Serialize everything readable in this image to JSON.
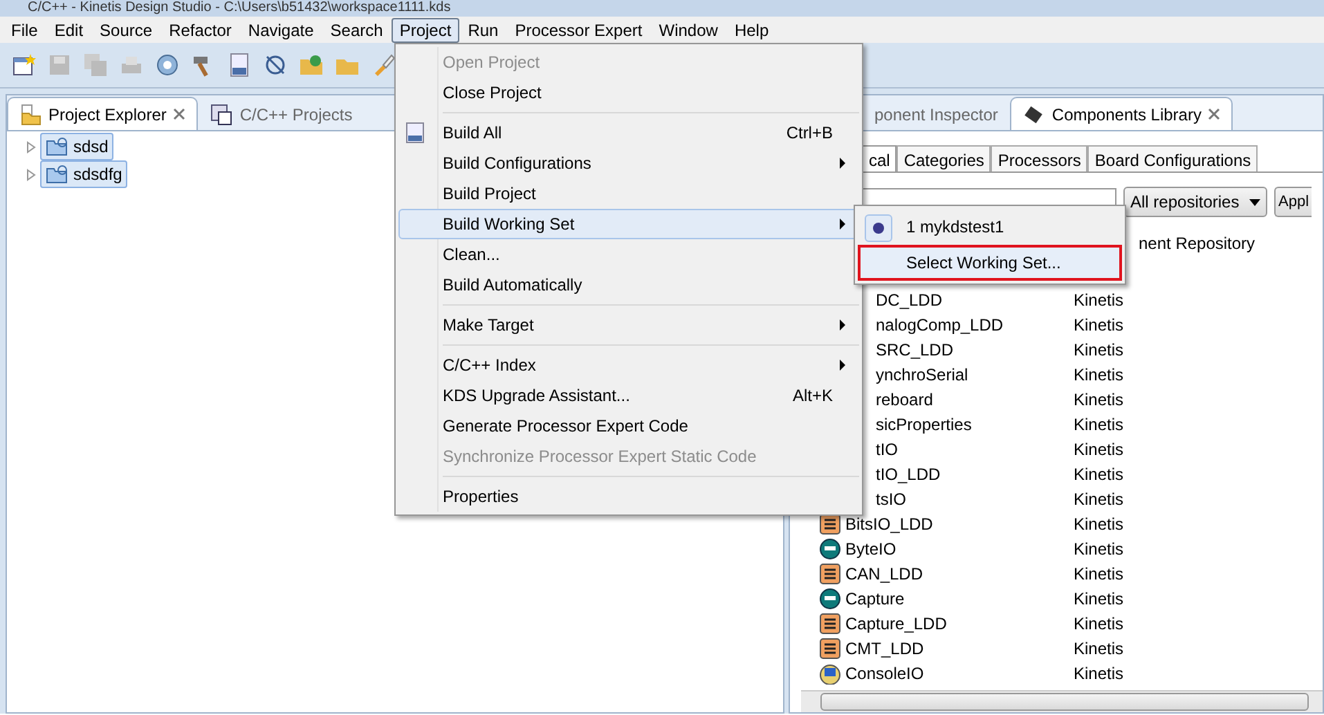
{
  "window": {
    "title": "C/C++ - Kinetis Design Studio - C:\\Users\\b51432\\workspace1111.kds"
  },
  "menu_bar": [
    {
      "label": "File",
      "selected": false
    },
    {
      "label": "Edit",
      "selected": false
    },
    {
      "label": "Source",
      "selected": false
    },
    {
      "label": "Refactor",
      "selected": false
    },
    {
      "label": "Navigate",
      "selected": false
    },
    {
      "label": "Search",
      "selected": false
    },
    {
      "label": "Project",
      "selected": true
    },
    {
      "label": "Run",
      "selected": false
    },
    {
      "label": "Processor Expert",
      "selected": false
    },
    {
      "label": "Window",
      "selected": false
    },
    {
      "label": "Help",
      "selected": false
    }
  ],
  "left_panel": {
    "tabs": [
      {
        "label": "Project Explorer",
        "selected": true
      },
      {
        "label": "C/C++ Projects",
        "selected": false
      }
    ],
    "tree": [
      {
        "label": "sdsd",
        "selected": true
      },
      {
        "label": "sdsdfg",
        "selected": true
      }
    ]
  },
  "right_panel": {
    "tabs": [
      {
        "label": "ponent Inspector",
        "selected": false
      },
      {
        "label": "Components Library",
        "selected": true
      }
    ],
    "sub_tabs": [
      {
        "label": "cal",
        "selected": true
      },
      {
        "label": "Categories",
        "selected": false
      },
      {
        "label": "Processors",
        "selected": false
      },
      {
        "label": "Board Configurations",
        "selected": false
      }
    ],
    "repository_select": "All repositories",
    "apply_button": "Appl",
    "column_2": "nent Repository",
    "rows": [
      {
        "name": "DC_LDD",
        "repository": "Kinetis",
        "kind": "covered"
      },
      {
        "name": "nalogComp_LDD",
        "repository": "Kinetis",
        "kind": "covered"
      },
      {
        "name": "SRC_LDD",
        "repository": "Kinetis",
        "kind": "covered"
      },
      {
        "name": "ynchroSerial",
        "repository": "Kinetis",
        "kind": "covered"
      },
      {
        "name": "reboard",
        "repository": "Kinetis",
        "kind": "covered"
      },
      {
        "name": "sicProperties",
        "repository": "Kinetis",
        "kind": "covered"
      },
      {
        "name": "tIO",
        "repository": "Kinetis",
        "kind": "covered"
      },
      {
        "name": "tIO_LDD",
        "repository": "Kinetis",
        "kind": "covered"
      },
      {
        "name": "tsIO",
        "repository": "Kinetis",
        "kind": "covered"
      },
      {
        "name": "BitsIO_LDD",
        "repository": "Kinetis",
        "kind": "square-chip"
      },
      {
        "name": "ByteIO",
        "repository": "Kinetis",
        "kind": "round-chip"
      },
      {
        "name": "CAN_LDD",
        "repository": "Kinetis",
        "kind": "square-chip"
      },
      {
        "name": "Capture",
        "repository": "Kinetis",
        "kind": "round-chip"
      },
      {
        "name": "Capture_LDD",
        "repository": "Kinetis",
        "kind": "square-chip"
      },
      {
        "name": "CMT_LDD",
        "repository": "Kinetis",
        "kind": "square-chip"
      },
      {
        "name": "ConsoleIO",
        "repository": "Kinetis",
        "kind": "monitor"
      }
    ]
  },
  "project_menu": [
    {
      "label": "Open Project",
      "disabled": true,
      "selected": false
    },
    {
      "label": "Close Project",
      "disabled": false,
      "selected": false
    },
    {
      "label": "Build All",
      "disabled": false,
      "selected": false,
      "shortcut": "Ctrl+B",
      "separator_before": true,
      "has_icon": true
    },
    {
      "label": "Build Configurations",
      "disabled": false,
      "selected": false,
      "submenu": true
    },
    {
      "label": "Build Project",
      "disabled": false,
      "selected": false
    },
    {
      "label": "Build Working Set",
      "disabled": false,
      "selected": true,
      "submenu": true
    },
    {
      "label": "Clean...",
      "disabled": false,
      "selected": false
    },
    {
      "label": "Build Automatically",
      "disabled": false,
      "selected": false
    },
    {
      "label": "Make Target",
      "disabled": false,
      "selected": false,
      "submenu": true,
      "separator_before": true
    },
    {
      "label": "C/C++ Index",
      "disabled": false,
      "selected": false,
      "submenu": true,
      "separator_before": true
    },
    {
      "label": "KDS Upgrade Assistant...",
      "disabled": false,
      "selected": false,
      "shortcut": "Alt+K"
    },
    {
      "label": "Generate Processor Expert Code",
      "disabled": false,
      "selected": false
    },
    {
      "label": "Synchronize Processor Expert Static Code",
      "disabled": true,
      "selected": false
    },
    {
      "label": "Properties",
      "disabled": false,
      "selected": false,
      "separator_before": true
    }
  ],
  "working_set_menu": [
    {
      "label": "1 mykdstest1",
      "checked": true,
      "highlighted": false
    },
    {
      "label": "Select Working Set...",
      "checked": false,
      "highlighted": true
    }
  ]
}
